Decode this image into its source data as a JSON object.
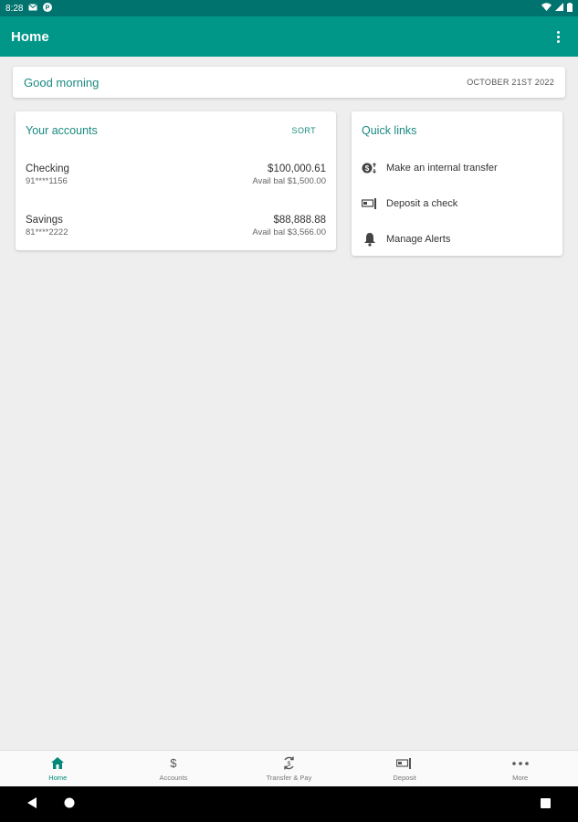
{
  "status_bar": {
    "time": "8:28"
  },
  "app_bar": {
    "title": "Home"
  },
  "greeting": {
    "message": "Good morning",
    "date": "OCTOBER 21ST 2022"
  },
  "accounts_card": {
    "title": "Your accounts",
    "sort_label": "SORT",
    "accounts": [
      {
        "name": "Checking",
        "number": "91****1156",
        "balance": "$100,000.61",
        "available": "Avail bal $1,500.00"
      },
      {
        "name": "Savings",
        "number": "81****2222",
        "balance": "$88,888.88",
        "available": "Avail bal $3,566.00"
      }
    ]
  },
  "quick_links": {
    "title": "Quick links",
    "items": [
      {
        "label": "Make an internal transfer",
        "icon": "transfer-icon"
      },
      {
        "label": "Deposit a check",
        "icon": "check-deposit-icon"
      },
      {
        "label": "Manage Alerts",
        "icon": "bell-icon"
      }
    ]
  },
  "bottom_nav": [
    {
      "label": "Home",
      "icon": "home-icon",
      "active": true
    },
    {
      "label": "Accounts",
      "icon": "dollar-icon",
      "active": false
    },
    {
      "label": "Transfer & Pay",
      "icon": "transfer-pay-icon",
      "active": false
    },
    {
      "label": "Deposit",
      "icon": "deposit-icon",
      "active": false
    },
    {
      "label": "More",
      "icon": "more-dots-icon",
      "active": false
    }
  ],
  "colors": {
    "primary": "#009688",
    "status_bar": "#00736e",
    "accent_text": "#1a8a80",
    "background": "#eeeeee"
  }
}
